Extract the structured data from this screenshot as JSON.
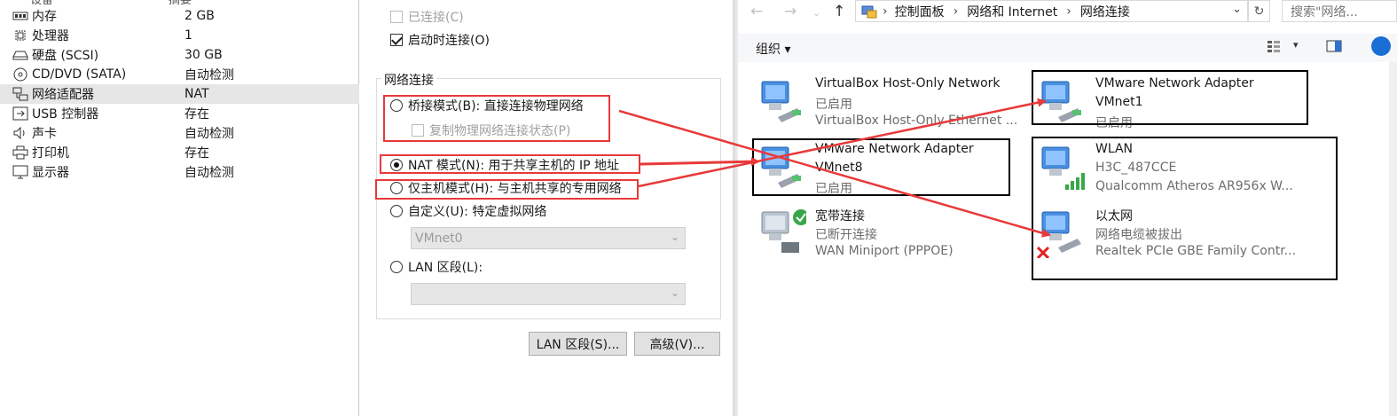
{
  "device_list": {
    "header_clip": "设备",
    "header_value_clip": "摘要",
    "items": [
      {
        "icon": "memory-icon",
        "name": "内存",
        "value": "2 GB"
      },
      {
        "icon": "cpu-icon",
        "name": "处理器",
        "value": "1"
      },
      {
        "icon": "harddisk-icon",
        "name": "硬盘 (SCSI)",
        "value": "30 GB"
      },
      {
        "icon": "cdrom-icon",
        "name": "CD/DVD (SATA)",
        "value": "自动检测"
      },
      {
        "icon": "network-adapter-icon",
        "name": "网络适配器",
        "value": "NAT"
      },
      {
        "icon": "usb-icon",
        "name": "USB 控制器",
        "value": "存在"
      },
      {
        "icon": "sound-icon",
        "name": "声卡",
        "value": "自动检测"
      },
      {
        "icon": "printer-icon",
        "name": "打印机",
        "value": "存在"
      },
      {
        "icon": "display-icon",
        "name": "显示器",
        "value": "自动检测"
      }
    ]
  },
  "device_status": {
    "connected_label": "已连接(C)",
    "connected_checked": false,
    "connect_at_power_on_label": "启动时连接(O)",
    "connect_at_power_on_checked": true
  },
  "network_connection": {
    "group_title": "网络连接",
    "bridged_label": "桥接模式(B): 直接连接物理网络",
    "replicate_label": "复制物理网络连接状态(P)",
    "nat_label": "NAT 模式(N): 用于共享主机的 IP 地址",
    "hostonly_label": "仅主机模式(H): 与主机共享的专用网络",
    "custom_label": "自定义(U): 特定虚拟网络",
    "custom_value": "VMnet0",
    "lan_label": "LAN 区段(L):",
    "lan_value": "",
    "selected": "nat"
  },
  "buttons": {
    "lan_segments": "LAN 区段(S)...",
    "advanced": "高级(V)..."
  },
  "explorer": {
    "breadcrumb": [
      "控制面板",
      "网络和 Internet",
      "网络连接"
    ],
    "search_placeholder": "搜索\"网络...",
    "organize_label": "组织 ▾",
    "connections": [
      {
        "name": "VirtualBox Host-Only Network",
        "status": "已启用",
        "device": "VirtualBox Host-Only Ethernet ..."
      },
      {
        "name": "VMware Network Adapter",
        "status": "VMnet1",
        "device": "已启用"
      },
      {
        "name": "VMware Network Adapter",
        "status": "VMnet8",
        "device": "已启用"
      },
      {
        "name": "WLAN",
        "status": "H3C_487CCE",
        "device": "Qualcomm Atheros AR956x W..."
      },
      {
        "name": "宽带连接",
        "status": "已断开连接",
        "device": "WAN Miniport (PPPOE)"
      },
      {
        "name": "以太网",
        "status": "网络电缆被拔出",
        "device": "Realtek PCIe GBE Family Contr..."
      }
    ]
  },
  "colors": {
    "annotation_red": "#e8393a",
    "annotation_black": "#000000",
    "selected_row": "#e6e6e6",
    "toolbar_bg": "#f6f7f9"
  }
}
